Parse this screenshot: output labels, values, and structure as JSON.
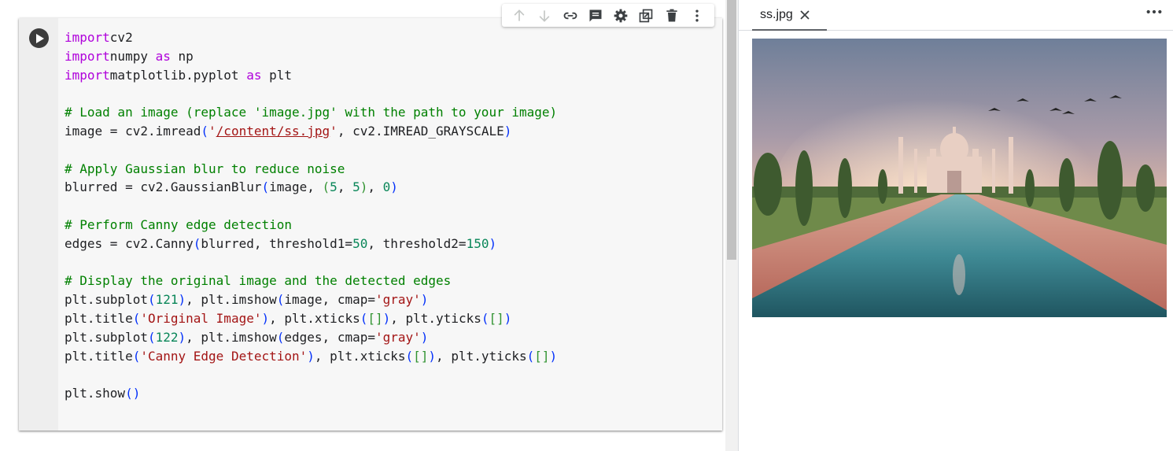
{
  "notebook": {
    "code_lines": [
      [
        [
          "kw",
          "import"
        ],
        [
          "",
          "cv2"
        ]
      ],
      [
        [
          "kw",
          "import"
        ],
        [
          "",
          "numpy "
        ],
        [
          "kw",
          "as"
        ],
        [
          "",
          " np"
        ]
      ],
      [
        [
          "kw",
          "import"
        ],
        [
          "",
          "matplotlib.pyplot "
        ],
        [
          "kw",
          "as"
        ],
        [
          "",
          " plt"
        ]
      ],
      [],
      [
        [
          "cm",
          "# Load an image (replace 'image.jpg' with the path to your image)"
        ]
      ],
      [
        [
          "",
          "image = cv2.imread"
        ],
        [
          "p1",
          "("
        ],
        [
          "st",
          "'"
        ],
        [
          "st u",
          "/content/ss.jpg"
        ],
        [
          "st",
          "'"
        ],
        [
          "",
          ", cv2.IMREAD_GRAYSCALE"
        ],
        [
          "p1",
          ")"
        ]
      ],
      [],
      [
        [
          "cm",
          "# Apply Gaussian blur to reduce noise"
        ]
      ],
      [
        [
          "",
          "blurred = cv2.GaussianBlur"
        ],
        [
          "p1",
          "("
        ],
        [
          "",
          "image, "
        ],
        [
          "p2",
          "("
        ],
        [
          "nu",
          "5"
        ],
        [
          "",
          ", "
        ],
        [
          "nu",
          "5"
        ],
        [
          "p2",
          ")"
        ],
        [
          "",
          ", "
        ],
        [
          "nu",
          "0"
        ],
        [
          "p1",
          ")"
        ]
      ],
      [],
      [
        [
          "cm",
          "# Perform Canny edge detection"
        ]
      ],
      [
        [
          "",
          "edges = cv2.Canny"
        ],
        [
          "p1",
          "("
        ],
        [
          "",
          "blurred, threshold1="
        ],
        [
          "nu",
          "50"
        ],
        [
          "",
          ", threshold2="
        ],
        [
          "nu",
          "150"
        ],
        [
          "p1",
          ")"
        ]
      ],
      [],
      [
        [
          "cm",
          "# Display the original image and the detected edges"
        ]
      ],
      [
        [
          "",
          "plt.subplot"
        ],
        [
          "p1",
          "("
        ],
        [
          "nu",
          "121"
        ],
        [
          "p1",
          ")"
        ],
        [
          "",
          ", plt.imshow"
        ],
        [
          "p1",
          "("
        ],
        [
          "",
          "image, cmap="
        ],
        [
          "st",
          "'gray'"
        ],
        [
          "p1",
          ")"
        ]
      ],
      [
        [
          "",
          "plt.title"
        ],
        [
          "p1",
          "("
        ],
        [
          "st",
          "'Original Image'"
        ],
        [
          "p1",
          ")"
        ],
        [
          "",
          ", plt.xticks"
        ],
        [
          "p1",
          "("
        ],
        [
          "p2",
          "[]"
        ],
        [
          "p1",
          ")"
        ],
        [
          "",
          ", plt.yticks"
        ],
        [
          "p1",
          "("
        ],
        [
          "p2",
          "[]"
        ],
        [
          "p1",
          ")"
        ]
      ],
      [
        [
          "",
          "plt.subplot"
        ],
        [
          "p1",
          "("
        ],
        [
          "nu",
          "122"
        ],
        [
          "p1",
          ")"
        ],
        [
          "",
          ", plt.imshow"
        ],
        [
          "p1",
          "("
        ],
        [
          "",
          "edges, cmap="
        ],
        [
          "st",
          "'gray'"
        ],
        [
          "p1",
          ")"
        ]
      ],
      [
        [
          "",
          "plt.title"
        ],
        [
          "p1",
          "("
        ],
        [
          "st",
          "'Canny Edge Detection'"
        ],
        [
          "p1",
          ")"
        ],
        [
          "",
          ", plt.xticks"
        ],
        [
          "p1",
          "("
        ],
        [
          "p2",
          "[]"
        ],
        [
          "p1",
          ")"
        ],
        [
          "",
          ", plt.yticks"
        ],
        [
          "p1",
          "("
        ],
        [
          "p2",
          "[]"
        ],
        [
          "p1",
          ")"
        ]
      ],
      [],
      [
        [
          "",
          "plt.show"
        ],
        [
          "p1",
          "()"
        ]
      ]
    ],
    "toolbar_icons": [
      "arrow-up-icon",
      "arrow-down-icon",
      "link-icon",
      "comment-icon",
      "gear-icon",
      "mirror-cell-icon",
      "trash-icon",
      "more-vert-icon"
    ]
  },
  "viewer": {
    "tab_label": "ss.jpg",
    "more_label": "•••",
    "image_subject": "taj-mahal-photo"
  },
  "colors": {
    "keyword": "#af00db",
    "comment": "#008000",
    "string": "#a31515",
    "number": "#098658",
    "paren": "#0431fa",
    "bracket": "#319331"
  }
}
